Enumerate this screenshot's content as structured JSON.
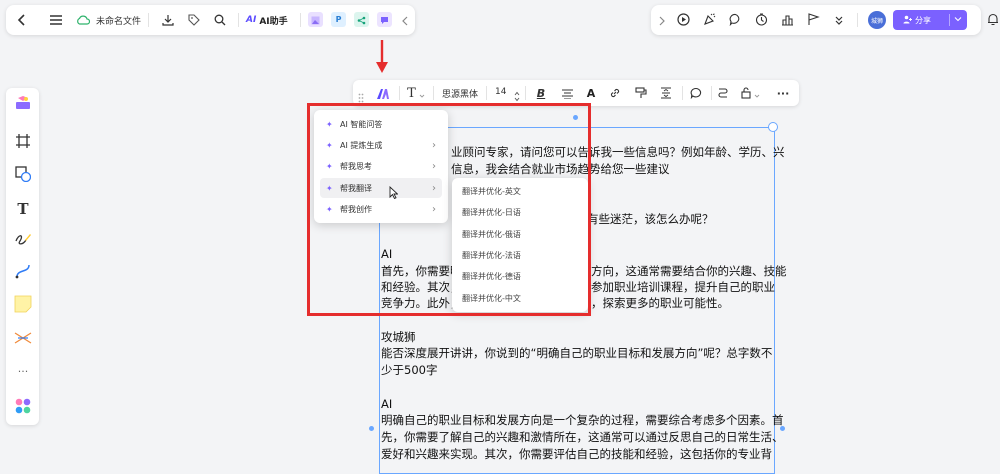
{
  "topbar": {
    "file_name": "未命名文件",
    "ai_assistant": "AI助手",
    "ai_logo": "AI",
    "share_label": "分享",
    "avatar_text": "城狮",
    "plugin_p": "P"
  },
  "format_toolbar": {
    "font_name": "思源黑体",
    "font_size": "14",
    "text_tool": "T",
    "color_tool": "A",
    "more": "···"
  },
  "ai_menu": {
    "items": [
      {
        "label": "AI 智能问答",
        "has_sub": false
      },
      {
        "label": "AI 提炼生成",
        "has_sub": true
      },
      {
        "label": "帮我思考",
        "has_sub": true
      },
      {
        "label": "帮我翻译",
        "has_sub": true
      },
      {
        "label": "帮我创作",
        "has_sub": true
      }
    ],
    "submenu": [
      "翻译并优化-英文",
      "翻译并优化-日语",
      "翻译并优化-俄语",
      "翻译并优化-法语",
      "翻译并优化-德语",
      "翻译并优化-中文"
    ]
  },
  "document": {
    "lines": [
      "业顾问专家，请问您可以告诉我一些信息吗？例如年龄、学历、兴",
      "信息，我会结合就业市场趋势给您一些建议",
      "有些迷茫，该怎么办呢？",
      "AI",
      "首先，你需要明",
      "方向，这通常需要结合你的兴趣、技能",
      "和经验。其次，",
      "参加职业培训课程，提升自己的职业",
      "竞争力。此外，",
      "，探索更多的职业可能性。",
      "攻城狮",
      "能否深度展开讲讲，你说到的“明确自己的职业目标和发展方向”呢？总字数不",
      "少于500字",
      "AI",
      "明确自己的职业目标和发展方向是一个复杂的过程，需要综合考虑多个因素。首",
      "先，你需要了解自己的兴趣和激情所在，这通常可以通过反思自己的日常生活、",
      "爱好和兴趣来实现。其次，你需要评估自己的技能和经验，这包括你的专业背"
    ]
  },
  "left_toolbar": {
    "text_tool": "T",
    "more": "···"
  },
  "colors": {
    "accent": "#7b61ff",
    "red_box": "#e52d2d",
    "selection": "#6aa7ff"
  }
}
